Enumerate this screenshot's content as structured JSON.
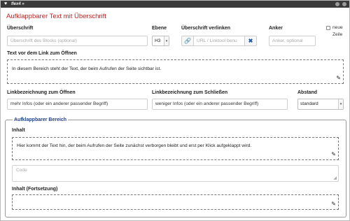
{
  "window": {
    "title": "flex4 »"
  },
  "main_title": "Aufklappbarer Text mit Überschrift",
  "heading": {
    "label": "Überschrift",
    "placeholder": "Überschrift des Blocks (optional)"
  },
  "level": {
    "label": "Ebene",
    "value": "H3"
  },
  "link": {
    "label": "Überschrift verlinken",
    "placeholder": "URL / Linktool benu"
  },
  "anchor": {
    "label": "Anker",
    "placeholder": "Anker, optional"
  },
  "new_line": {
    "label_line1": "neue",
    "label_line2": "Zeile",
    "checked": false
  },
  "text_before": {
    "label": "Text vor dem Link zum Öffnen",
    "content": "In diesem Bereich steht der Text, der beim Aufrufen der Seite sichtbar ist."
  },
  "open_link": {
    "label": "Linkbezeichnung zum Öffnen",
    "value": "mehr Infos (oder ein anderer passender Begriff)"
  },
  "close_link": {
    "label": "Linkbezeichnung zum Schließen",
    "value": "weniger Infos (oder ein anderer passender Begriff)"
  },
  "spacing": {
    "label": "Abstand",
    "value": "standard"
  },
  "collapsible": {
    "legend": "Aufklappbarer Bereich",
    "content_label": "Inhalt",
    "content_text": "Hier kommt der Text hin, der beim Aufrufen der Seite zunächst verborgen bleibt und erst per Klick aufgeklappt wird.",
    "code_placeholder": "Code",
    "continuation_label": "Inhalt (Fortsetzung)"
  },
  "icons": {
    "app": "heart-icon",
    "link": "link-icon",
    "clear": "clear-x-icon",
    "edit": "pencil-icon"
  },
  "colors": {
    "title_red": "#cc1e1e",
    "legend_blue": "#1f3f8a",
    "titlebar": "#3a3a3a"
  }
}
